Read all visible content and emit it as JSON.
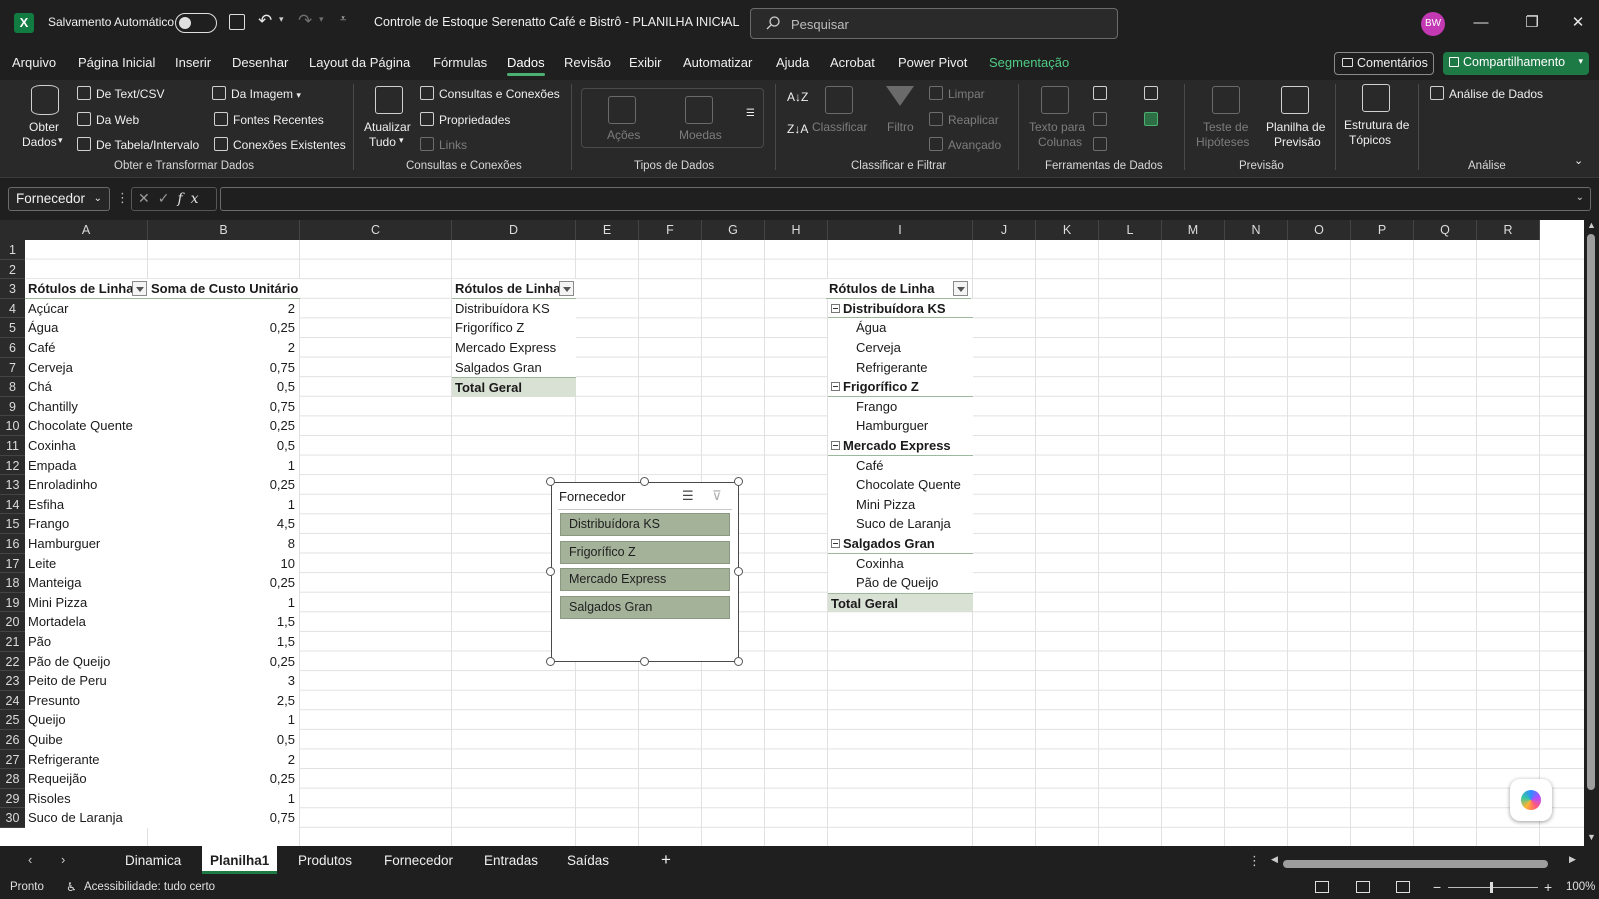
{
  "titlebar": {
    "autosave_label": "Salvamento Automático",
    "doc_title": "Controle de Estoque Serenatto Café e Bistrô - PLANILHA INICIAL",
    "search_placeholder": "Pesquisar",
    "avatar_initials": "BW"
  },
  "menu": {
    "tabs": [
      "Arquivo",
      "Página Inicial",
      "Inserir",
      "Desenhar",
      "Layout da Página",
      "Fórmulas",
      "Dados",
      "Revisão",
      "Exibir",
      "Automatizar",
      "Ajuda",
      "Acrobat",
      "Power Pivot",
      "Segmentação"
    ],
    "active": "Dados",
    "comments_label": "Comentários",
    "share_label": "Compartilhamento"
  },
  "ribbon": {
    "get_data": {
      "label1": "Obter",
      "label2": "Dados"
    },
    "from_text": "De Text/CSV",
    "from_web": "Da Web",
    "from_table": "De Tabela/Intervalo",
    "from_image": "Da Imagem",
    "recent_sources": "Fontes Recentes",
    "existing_connections": "Conexões Existentes",
    "group_get": "Obter e Transformar Dados",
    "refresh": {
      "label1": "Atualizar",
      "label2": "Tudo"
    },
    "queries": "Consultas e Conexões",
    "properties": "Propriedades",
    "links": "Links",
    "group_queries": "Consultas e Conexões",
    "stocks": "Ações",
    "currencies": "Moedas",
    "group_datatypes": "Tipos de Dados",
    "sort": "Classificar",
    "filter": "Filtro",
    "clear": "Limpar",
    "reapply": "Reaplicar",
    "advanced": "Avançado",
    "group_sort": "Classificar e Filtrar",
    "text_to_columns": {
      "label1": "Texto para",
      "label2": "Colunas"
    },
    "group_tools": "Ferramentas de Dados",
    "whatif": {
      "label1": "Teste de",
      "label2": "Hipóteses"
    },
    "forecast": {
      "label1": "Planilha de",
      "label2": "Previsão"
    },
    "group_forecast": "Previsão",
    "outline": {
      "label1": "Estrutura de",
      "label2": "Tópicos"
    },
    "data_analysis": "Análise de Dados",
    "group_analysis": "Análise"
  },
  "formula_bar": {
    "name_box": "Fornecedor",
    "fx": "fx",
    "value": ""
  },
  "columns": [
    "A",
    "B",
    "C",
    "D",
    "E",
    "F",
    "G",
    "H",
    "I",
    "J",
    "K",
    "L",
    "M",
    "N",
    "O",
    "P",
    "Q",
    "R"
  ],
  "rows": [
    "1",
    "2",
    "3",
    "4",
    "5",
    "6",
    "7",
    "8",
    "9",
    "10",
    "11",
    "12",
    "13",
    "14",
    "15",
    "16",
    "17",
    "18",
    "19",
    "20",
    "21",
    "22",
    "23",
    "24",
    "25",
    "26",
    "27",
    "28",
    "29",
    "30"
  ],
  "pivot1": {
    "header_label": "Rótulos de Linha",
    "header_value": "Soma de Custo Unitário",
    "rows": [
      {
        "label": "Açúcar",
        "value": "2"
      },
      {
        "label": "Água",
        "value": "0,25"
      },
      {
        "label": "Café",
        "value": "2"
      },
      {
        "label": "Cerveja",
        "value": "0,75"
      },
      {
        "label": "Chá",
        "value": "0,5"
      },
      {
        "label": "Chantilly",
        "value": "0,75"
      },
      {
        "label": "Chocolate Quente",
        "value": "0,25"
      },
      {
        "label": "Coxinha",
        "value": "0,5"
      },
      {
        "label": "Empada",
        "value": "1"
      },
      {
        "label": "Enroladinho",
        "value": "0,25"
      },
      {
        "label": "Esfiha",
        "value": "1"
      },
      {
        "label": "Frango",
        "value": "4,5"
      },
      {
        "label": "Hamburguer",
        "value": "8"
      },
      {
        "label": "Leite",
        "value": "10"
      },
      {
        "label": "Manteiga",
        "value": "0,25"
      },
      {
        "label": "Mini Pizza",
        "value": "1"
      },
      {
        "label": "Mortadela",
        "value": "1,5"
      },
      {
        "label": "Pão",
        "value": "1,5"
      },
      {
        "label": "Pão de Queijo",
        "value": "0,25"
      },
      {
        "label": "Peito de Peru",
        "value": "3"
      },
      {
        "label": "Presunto",
        "value": "2,5"
      },
      {
        "label": "Queijo",
        "value": "1"
      },
      {
        "label": "Quibe",
        "value": "0,5"
      },
      {
        "label": "Refrigerante",
        "value": "2"
      },
      {
        "label": "Requeijão",
        "value": "0,25"
      },
      {
        "label": "Risoles",
        "value": "1"
      },
      {
        "label": "Suco de Laranja",
        "value": "0,75"
      }
    ]
  },
  "pivot2": {
    "header_label": "Rótulos de Linha",
    "rows": [
      "Distribuídora KS",
      "Frigorífico Z",
      "Mercado Express",
      "Salgados Gran"
    ],
    "total": "Total Geral"
  },
  "pivot3": {
    "header_label": "Rótulos de Linha",
    "items": [
      {
        "label": "Distribuídora KS",
        "group": true
      },
      {
        "label": "Água",
        "group": false
      },
      {
        "label": "Cerveja",
        "group": false
      },
      {
        "label": "Refrigerante",
        "group": false
      },
      {
        "label": "Frigorífico Z",
        "group": true
      },
      {
        "label": "Frango",
        "group": false
      },
      {
        "label": "Hamburguer",
        "group": false
      },
      {
        "label": "Mercado Express",
        "group": true
      },
      {
        "label": "Café",
        "group": false
      },
      {
        "label": "Chocolate Quente",
        "group": false
      },
      {
        "label": "Mini Pizza",
        "group": false
      },
      {
        "label": "Suco de Laranja",
        "group": false
      },
      {
        "label": "Salgados Gran",
        "group": true
      },
      {
        "label": "Coxinha",
        "group": false
      },
      {
        "label": "Pão de Queijo",
        "group": false
      }
    ],
    "total": "Total Geral"
  },
  "slicer": {
    "title": "Fornecedor",
    "items": [
      "Distribuídora KS",
      "Frigorífico Z",
      "Mercado Express",
      "Salgados Gran"
    ]
  },
  "sheets": {
    "tabs": [
      "Dinamica",
      "Planilha1",
      "Produtos",
      "Fornecedor",
      "Entradas",
      "Saídas"
    ],
    "active": "Planilha1",
    "add": "+"
  },
  "status": {
    "ready": "Pronto",
    "accessibility": "Acessibilidade: tudo certo",
    "zoom": "100%"
  },
  "colors": {
    "accent": "#1e7a45",
    "pivot_total_bg": "#d9e1d5",
    "slicer_item": "#a5b29a",
    "avatar": "#c239b3"
  }
}
